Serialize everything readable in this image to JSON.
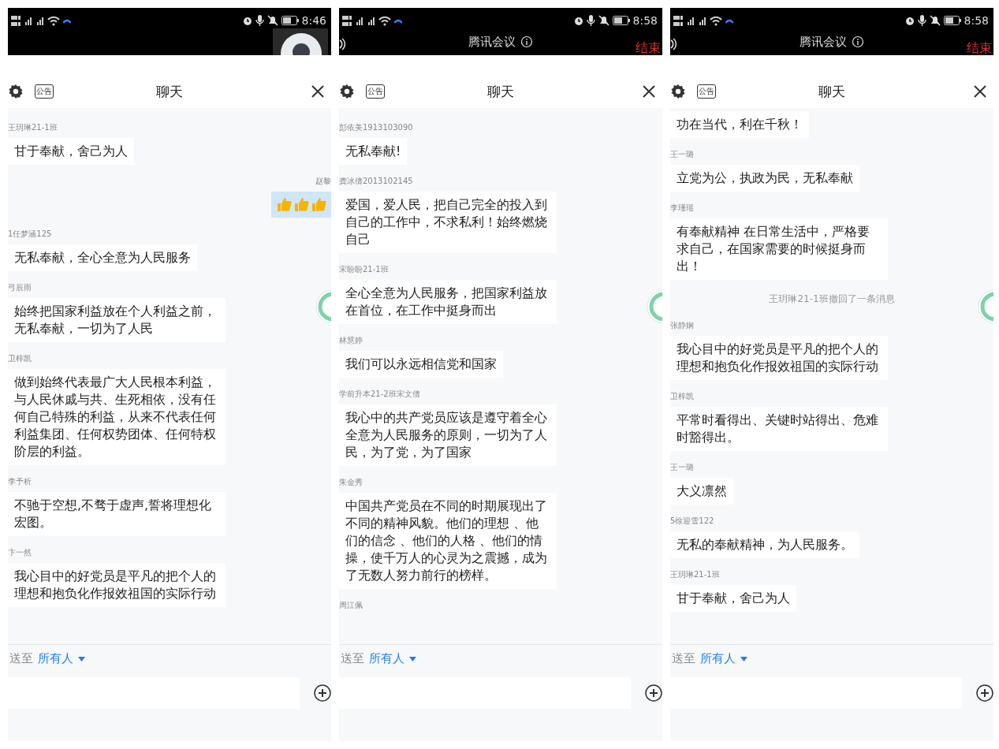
{
  "panels": [
    {
      "status_bar": {
        "time": "8:46"
      },
      "top": {
        "kind": "video"
      },
      "header": {
        "notice_label": "公告",
        "title": "聊天"
      },
      "messages": [
        {
          "kind": "text",
          "sender": "王玥琳21-1班",
          "text": "甘于奉献，舍己为人"
        },
        {
          "kind": "thumbs",
          "sender": "赵黎"
        },
        {
          "kind": "text",
          "sender": "1任梦涵125",
          "text": "无私奉献，全心全意为人民服务"
        },
        {
          "kind": "text",
          "sender": "弓辰雨",
          "text": "始终把国家利益放在个人利益之前，无私奉献，一切为了人民"
        },
        {
          "kind": "text",
          "sender": "卫梓凯",
          "text": "做到始终代表最广大人民根本利益，与人民休戚与共、生死相依，没有任何自己特殊的利益，从来不代表任何利益集团、任何权势团体、任何特权阶层的利益。"
        },
        {
          "kind": "text",
          "sender": "李予析",
          "text": "不驰于空想,不骛于虚声,誓将理想化宏图。"
        },
        {
          "kind": "text",
          "sender": "卞一然",
          "text": "我心目中的好党员是平凡的把个人的理想和抱负化作报效祖国的实际行动"
        }
      ],
      "footer": {
        "send_to_label": "送至",
        "recipient": "所有人"
      }
    },
    {
      "status_bar": {
        "time": "8:58"
      },
      "top": {
        "kind": "meeting",
        "title": "腾讯会议",
        "end_label": "结束"
      },
      "header": {
        "notice_label": "公告",
        "title": "聊天"
      },
      "messages": [
        {
          "kind": "text",
          "sender": "彭依美1913103090",
          "text": "无私奉献!"
        },
        {
          "kind": "text",
          "sender": "龚冰倩2013102145",
          "text": "爱国，爱人民，把自己完全的投入到自己的工作中，不求私利！始终燃烧自己"
        },
        {
          "kind": "text",
          "sender": "宋盼盼21-1班",
          "text": "全心全意为人民服务，把国家利益放在首位，在工作中挺身而出"
        },
        {
          "kind": "text",
          "sender": "林慧婷",
          "text": "我们可以永远相信党和国家"
        },
        {
          "kind": "text",
          "sender": "学前升本21-2班宋文倩",
          "text": "我心中的共产党员应该是遵守着全心全意为人民服务的原则，一切为了人民，为了党，为了国家"
        },
        {
          "kind": "text",
          "sender": "朱金秀",
          "text": "中国共产党员在不同的时期展现出了不同的精神风貌。他们的理想 、他们的信念 、他们的人格 、他们的情操，使千万人的心灵为之震撼，成为了无数人努力前行的榜样。"
        },
        {
          "kind": "sender_only",
          "sender": "周江佩"
        }
      ],
      "footer": {
        "send_to_label": "送至",
        "recipient": "所有人"
      }
    },
    {
      "status_bar": {
        "time": "8:58"
      },
      "top": {
        "kind": "meeting",
        "title": "腾讯会议",
        "end_label": "结束"
      },
      "header": {
        "notice_label": "公告",
        "title": "聊天"
      },
      "messages": [
        {
          "kind": "text",
          "text": "功在当代，利在千秋！"
        },
        {
          "kind": "text",
          "sender": "王一璐",
          "text": "立党为公，执政为民，无私奉献"
        },
        {
          "kind": "text",
          "sender": "李瑾瑶",
          "text": "有奉献精神 在日常生活中，严格要求自己，在国家需要的时候挺身而出！"
        },
        {
          "kind": "notice",
          "text": "王玥琳21-1班撤回了一条消息"
        },
        {
          "kind": "text",
          "sender": "张静娴",
          "text": "我心目中的好党员是平凡的把个人的理想和抱负化作报效祖国的实际行动"
        },
        {
          "kind": "text",
          "sender": "卫梓凯",
          "text": "平常时看得出、关键时站得出、危难时豁得出。"
        },
        {
          "kind": "text",
          "sender": "王一璐",
          "text": "大义凛然"
        },
        {
          "kind": "text",
          "sender": "5徐迎雪122",
          "text": "无私的奉献精神，为人民服务。"
        },
        {
          "kind": "text",
          "sender": "王玥琳21-1班",
          "text": "甘于奉献，舍己为人"
        }
      ],
      "footer": {
        "send_to_label": "送至",
        "recipient": "所有人"
      }
    }
  ]
}
